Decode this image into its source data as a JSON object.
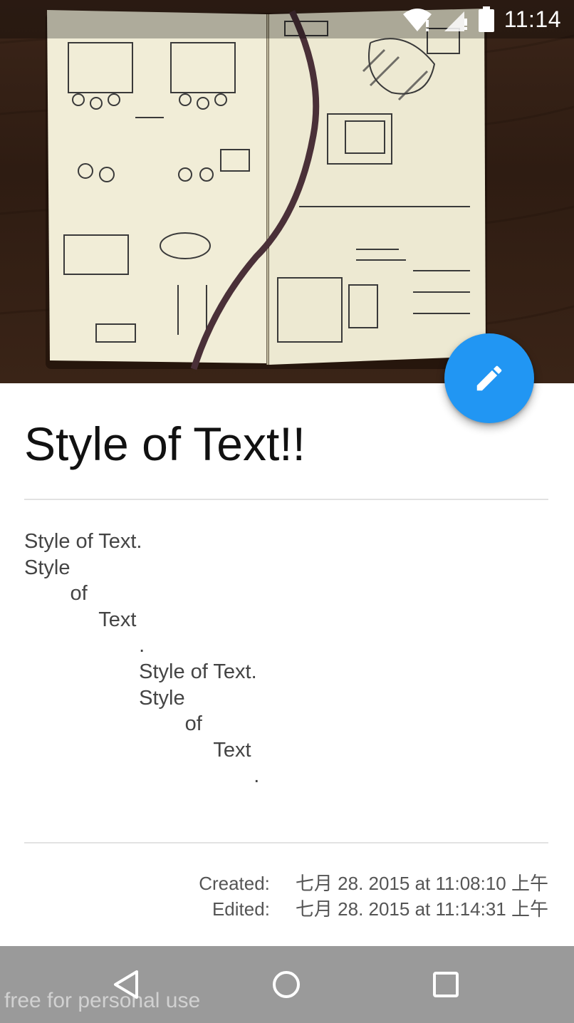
{
  "status_bar": {
    "time": "11:14",
    "icons": [
      "wifi-icon",
      "signal-icon",
      "battery-icon"
    ]
  },
  "header_image": {
    "description_icon": "notebook-sketch-photo"
  },
  "fab": {
    "icon": "pencil-icon",
    "color": "#2196f3"
  },
  "note": {
    "title": "Style of Text!!",
    "body_lines": [
      "Style of Text.",
      "Style",
      "        of",
      "             Text",
      "                    .",
      "                    Style of Text.",
      "                    Style",
      "                            of",
      "                                 Text",
      "                                        ."
    ]
  },
  "meta": {
    "created_label": "Created:",
    "created_value": "七月 28. 2015 at 11:08:10 上午",
    "edited_label": "Edited:",
    "edited_value": "七月 28. 2015 at 11:14:31 上午"
  },
  "nav_bar": {
    "buttons": [
      "back-icon",
      "home-icon",
      "recents-icon"
    ]
  },
  "watermark": "free for personal use"
}
